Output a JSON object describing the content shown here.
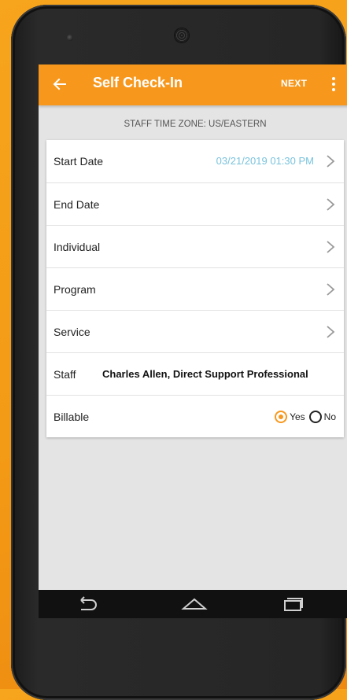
{
  "app": {
    "title": "Self Check-In",
    "next_label": "NEXT"
  },
  "timezone_label": "STAFF TIME ZONE: US/EASTERN",
  "form": {
    "start_date": {
      "label": "Start Date",
      "value": "03/21/2019 01:30 PM"
    },
    "end_date": {
      "label": "End Date",
      "value": ""
    },
    "individual": {
      "label": "Individual",
      "value": ""
    },
    "program": {
      "label": "Program",
      "value": ""
    },
    "service": {
      "label": "Service",
      "value": ""
    },
    "staff": {
      "label": "Staff",
      "value": "Charles Allen, Direct Support Professional"
    },
    "billable": {
      "label": "Billable",
      "options": [
        "Yes",
        "No"
      ],
      "selected": "Yes"
    }
  },
  "colors": {
    "accent": "#f7981d",
    "date_value": "#79c3dd",
    "screen_bg": "#e4e4e4",
    "background": "#f39a16"
  },
  "icons": {
    "back": "arrow-left-icon",
    "menu": "vertical-dots-icon",
    "chevron": "chevron-right-icon",
    "nav_back": "nav-back-icon",
    "nav_home": "nav-home-icon",
    "nav_recents": "nav-recents-icon"
  }
}
